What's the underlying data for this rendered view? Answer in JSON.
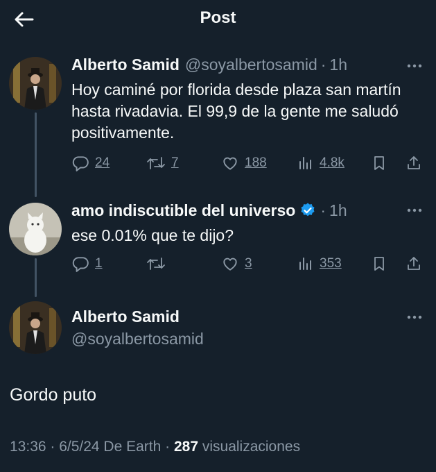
{
  "header": {
    "title": "Post"
  },
  "tweets": [
    {
      "name": "Alberto Samid",
      "handle": "@soyalbertosamid",
      "dot": "·",
      "time": "1h",
      "text": "Hoy caminé por florida desde plaza san martín hasta rivadavia. El 99,9 de la gente me saludó positivamente.",
      "replies": "24",
      "reposts": "7",
      "likes": "188",
      "views": "4.8k"
    },
    {
      "name": "amo indiscutible del universo",
      "verified": true,
      "dot": "·",
      "time": "1h",
      "text": "ese 0.01% que te dijo?",
      "replies": "1",
      "reposts": "",
      "likes": "3",
      "views": "353"
    }
  ],
  "main_post": {
    "name": "Alberto Samid",
    "handle": "@soyalbertosamid",
    "text": "Gordo puto",
    "meta_prefix": "13:36 · 6/5/24 De Earth · ",
    "views": "287",
    "views_label": " visualizaciones"
  },
  "icons": [
    "back-arrow-icon",
    "more-icon",
    "reply-icon",
    "repost-icon",
    "like-icon",
    "views-icon",
    "bookmark-icon",
    "share-icon",
    "verified-badge-icon"
  ],
  "colors": {
    "background": "#15202b",
    "text": "#f7f9f9",
    "muted": "#8b98a5",
    "verified": "#1d9bf0"
  }
}
